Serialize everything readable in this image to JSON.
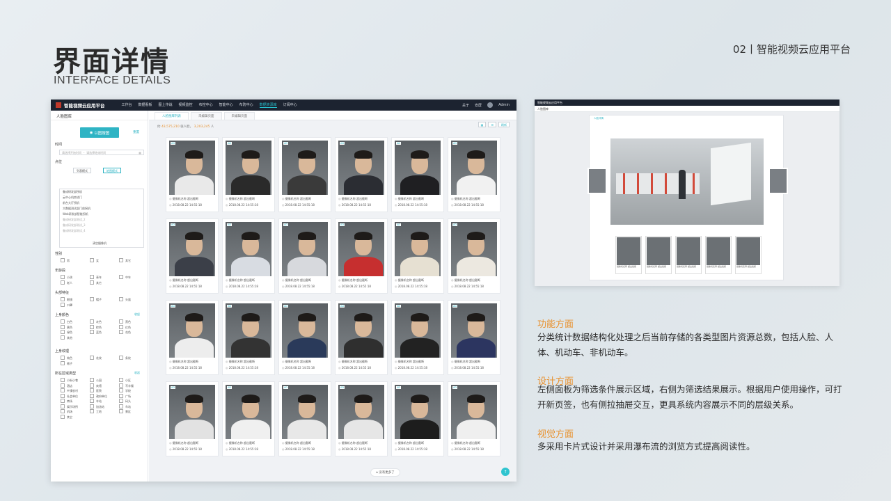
{
  "header": {
    "title": "界面详情",
    "subtitle": "INTERFACE DETAILS",
    "page_label": "02丨智能视频云应用平台"
  },
  "app": {
    "title": "智能视频云应用平台",
    "nav": [
      "工作台",
      "数据看板",
      "图上作战",
      "视频监控",
      "布控中心",
      "智能中心",
      "布防中心",
      "数据资源库",
      "订阅中心"
    ],
    "active_nav": "数据资源库",
    "top_right": [
      "关于",
      "安屏",
      "Admin"
    ]
  },
  "sidebar": {
    "heading": "人脸图库",
    "search_button": "以图搜图",
    "reset": "重置",
    "time_label": "时间",
    "time_start_placeholder": "请选择开始时间",
    "time_end_placeholder": "请选择结束时间",
    "location_label": "点位",
    "mode_list": "列表模式",
    "mode_map": "地图模式",
    "cameras": [
      "鲁成研发部拐机",
      "云中心机房进门",
      "前台大厅拐机",
      "大数据测试部门前拐机",
      "Web研发部智能拐机",
      "鲁成研发部测试_2",
      "鲁成研发部测试_3",
      "鲁成研发部测试_4"
    ],
    "clear_cameras": "清空摄像机",
    "gender_label": "性别",
    "gender": [
      "男",
      "女",
      "其它"
    ],
    "age_label": "年龄段",
    "age": [
      "小孩",
      "青年",
      "中年",
      "老人",
      "其它"
    ],
    "head_label": "头部特征",
    "head": [
      "眼镜",
      "帽子",
      "头盔",
      "口罩"
    ],
    "color_label": "上身颜色",
    "collapse": "收起",
    "colors": [
      "白色",
      "灰色",
      "黑色",
      "黄色",
      "棕色",
      "红色",
      "绿色",
      "蓝色",
      "花色",
      "其他"
    ],
    "texture_label": "上身纹理",
    "texture": [
      "纯色",
      "花纹",
      "条纹",
      "格子"
    ],
    "area_label": "所在区域类型",
    "areas": [
      "小街小巷",
      "公园",
      "小区",
      "酒店",
      "宾馆",
      "写字楼",
      "乡镇农村",
      "医院",
      "学校",
      "社会单位",
      "政府单位",
      "广场",
      "商场",
      "车站",
      "码头",
      "娱乐场所",
      "加油站",
      "车站",
      "机场",
      "工地",
      "景区",
      "其它"
    ]
  },
  "content": {
    "tabs": [
      "人脸图库列表",
      "未编辑页面",
      "未编辑页面"
    ],
    "stats_prefix": "约",
    "stats_total": "43,575,210",
    "stats_mid": "张人脸，",
    "stats_count": "3,203,245",
    "stats_suffix": "人",
    "refresh": "刷新",
    "card_camera": "摄像机名称 超出截断",
    "card_time": "2018.08.22 14:55:18",
    "card_tag": "AD",
    "no_more": "没有更多了"
  },
  "colors": {
    "accent": "#2fb4c4",
    "orange": "#e8912e",
    "topbar": "#1c2330"
  },
  "shot2": {
    "title": "智能视频云应用平台",
    "heading": "人脸图库",
    "tab": "人脸详情",
    "thumb_caption": "摄像机名称 超出截断"
  },
  "sections": [
    {
      "heading": "功能方面",
      "body": "分类统计数据结构化处理之后当前存储的各类型图片资源总数，包括人脸、人体、机动车、非机动车。"
    },
    {
      "heading": "设计方面",
      "body": "左侧面板为筛选条件展示区域，右侧为筛选结果展示。根据用户使用操作，可打开新页签，也有侧拉抽屉交互，更具系统内容展示不同的层级关系。"
    },
    {
      "heading": "视觉方面",
      "body": "多采用卡片式设计并采用瀑布流的浏览方式提高阅读性。"
    }
  ]
}
